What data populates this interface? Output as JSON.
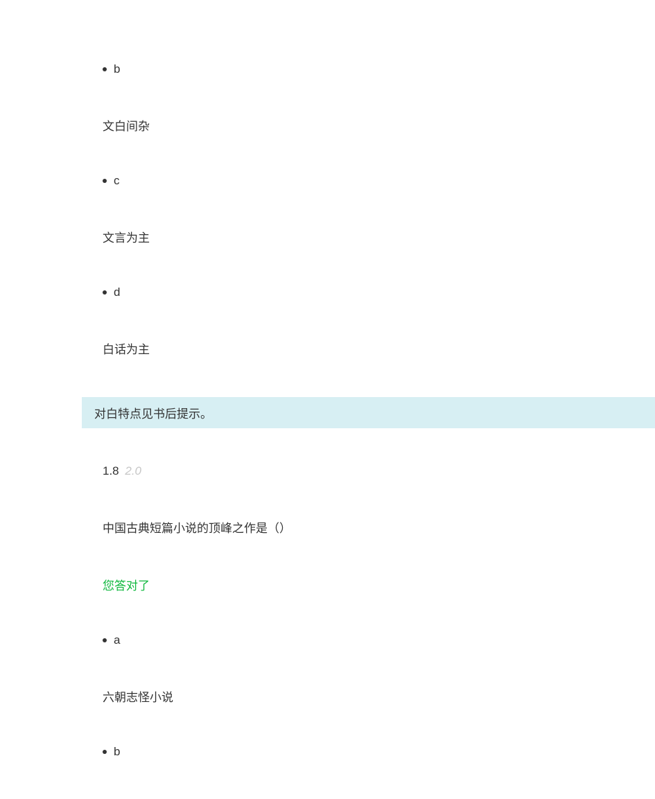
{
  "q7_options": [
    {
      "letter": "b",
      "text": "文白间杂"
    },
    {
      "letter": "c",
      "text": "文言为主"
    },
    {
      "letter": "d",
      "text": "白话为主"
    }
  ],
  "hint": "对白特点见书后提示。",
  "q8": {
    "number": "1.8",
    "score": "2.0",
    "text": "中国古典短篇小说的顶峰之作是（）",
    "feedback": "您答对了",
    "options": [
      {
        "letter": "a",
        "text": "六朝志怪小说"
      },
      {
        "letter": "b",
        "text": ""
      }
    ]
  }
}
